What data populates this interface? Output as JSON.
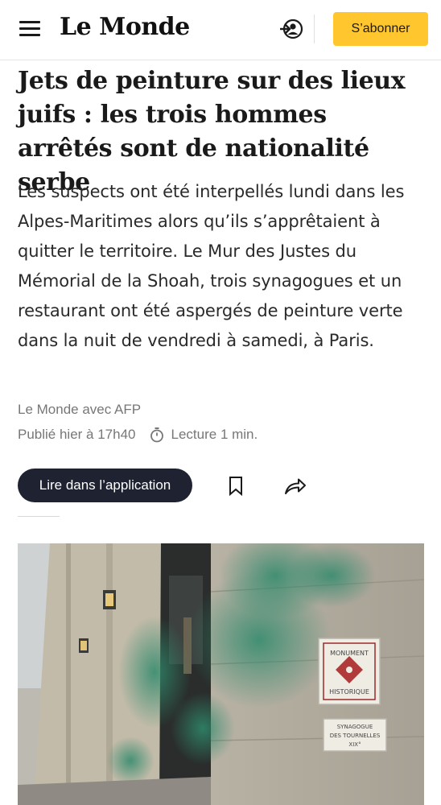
{
  "header": {
    "logo": "Le Monde",
    "subscribe_label": "S’abonner",
    "menu_icon": "hamburger-menu-icon",
    "account_icon": "account-login-icon"
  },
  "article": {
    "title": "Jets de peinture sur des lieux juifs : les trois hommes arrêtés sont de nationalité serbe",
    "lede": "Les suspects ont été interpellés lundi dans les Alpes-Maritimes alors qu’ils s’apprêtaient à quitter le territoire. Le Mur des Justes du Mémorial de la Shoah, trois synagogues et un restaurant ont été aspergés de peinture verte dans la nuit de vendredi à samedi, à Paris.",
    "byline": "Le Monde avec AFP",
    "published": "Publié hier à 17h40",
    "reading_time": "Lecture 1 min."
  },
  "actions": {
    "app_button_label": "Lire dans l’application",
    "bookmark_icon": "bookmark-icon",
    "share_icon": "share-icon"
  },
  "photo": {
    "plaque_top_line1": "MONUMENT",
    "plaque_top_line2": "HISTORIQUE",
    "plaque_bottom_line1": "SYNAGOGUE",
    "plaque_bottom_line2": "DES TOURNELLES",
    "plaque_bottom_line3": "XIX°"
  },
  "colors": {
    "subscribe_bg": "#ffc62e",
    "app_button_bg": "#1f2230",
    "paint_green": "#2f8a6c"
  }
}
